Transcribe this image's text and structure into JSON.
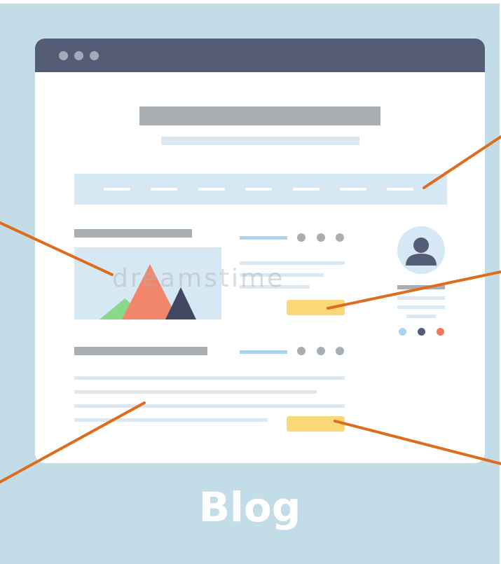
{
  "caption": "Blog",
  "watermark": "dreamstime",
  "colors": {
    "background": "#c3dde8",
    "titlebar": "#555c76",
    "window_dots": "#a6aab6",
    "heading_bar": "#a9aeb3",
    "light_bar": "#dbe7f1",
    "nav_band": "#d7e8f5",
    "button": "#fbd976",
    "callout_line": "#de6c1c",
    "mountain_green": "#88d98a",
    "mountain_orange": "#f2866b",
    "mountain_dark": "#3f4761",
    "accent_blue": "#a9d4ec",
    "accent_orange": "#f0775b"
  },
  "icons": {
    "window_controls": "three-dots-icon",
    "hero_image": "mountain-image-icon",
    "avatar": "user-avatar-icon",
    "meta": "three-dots-icon"
  }
}
